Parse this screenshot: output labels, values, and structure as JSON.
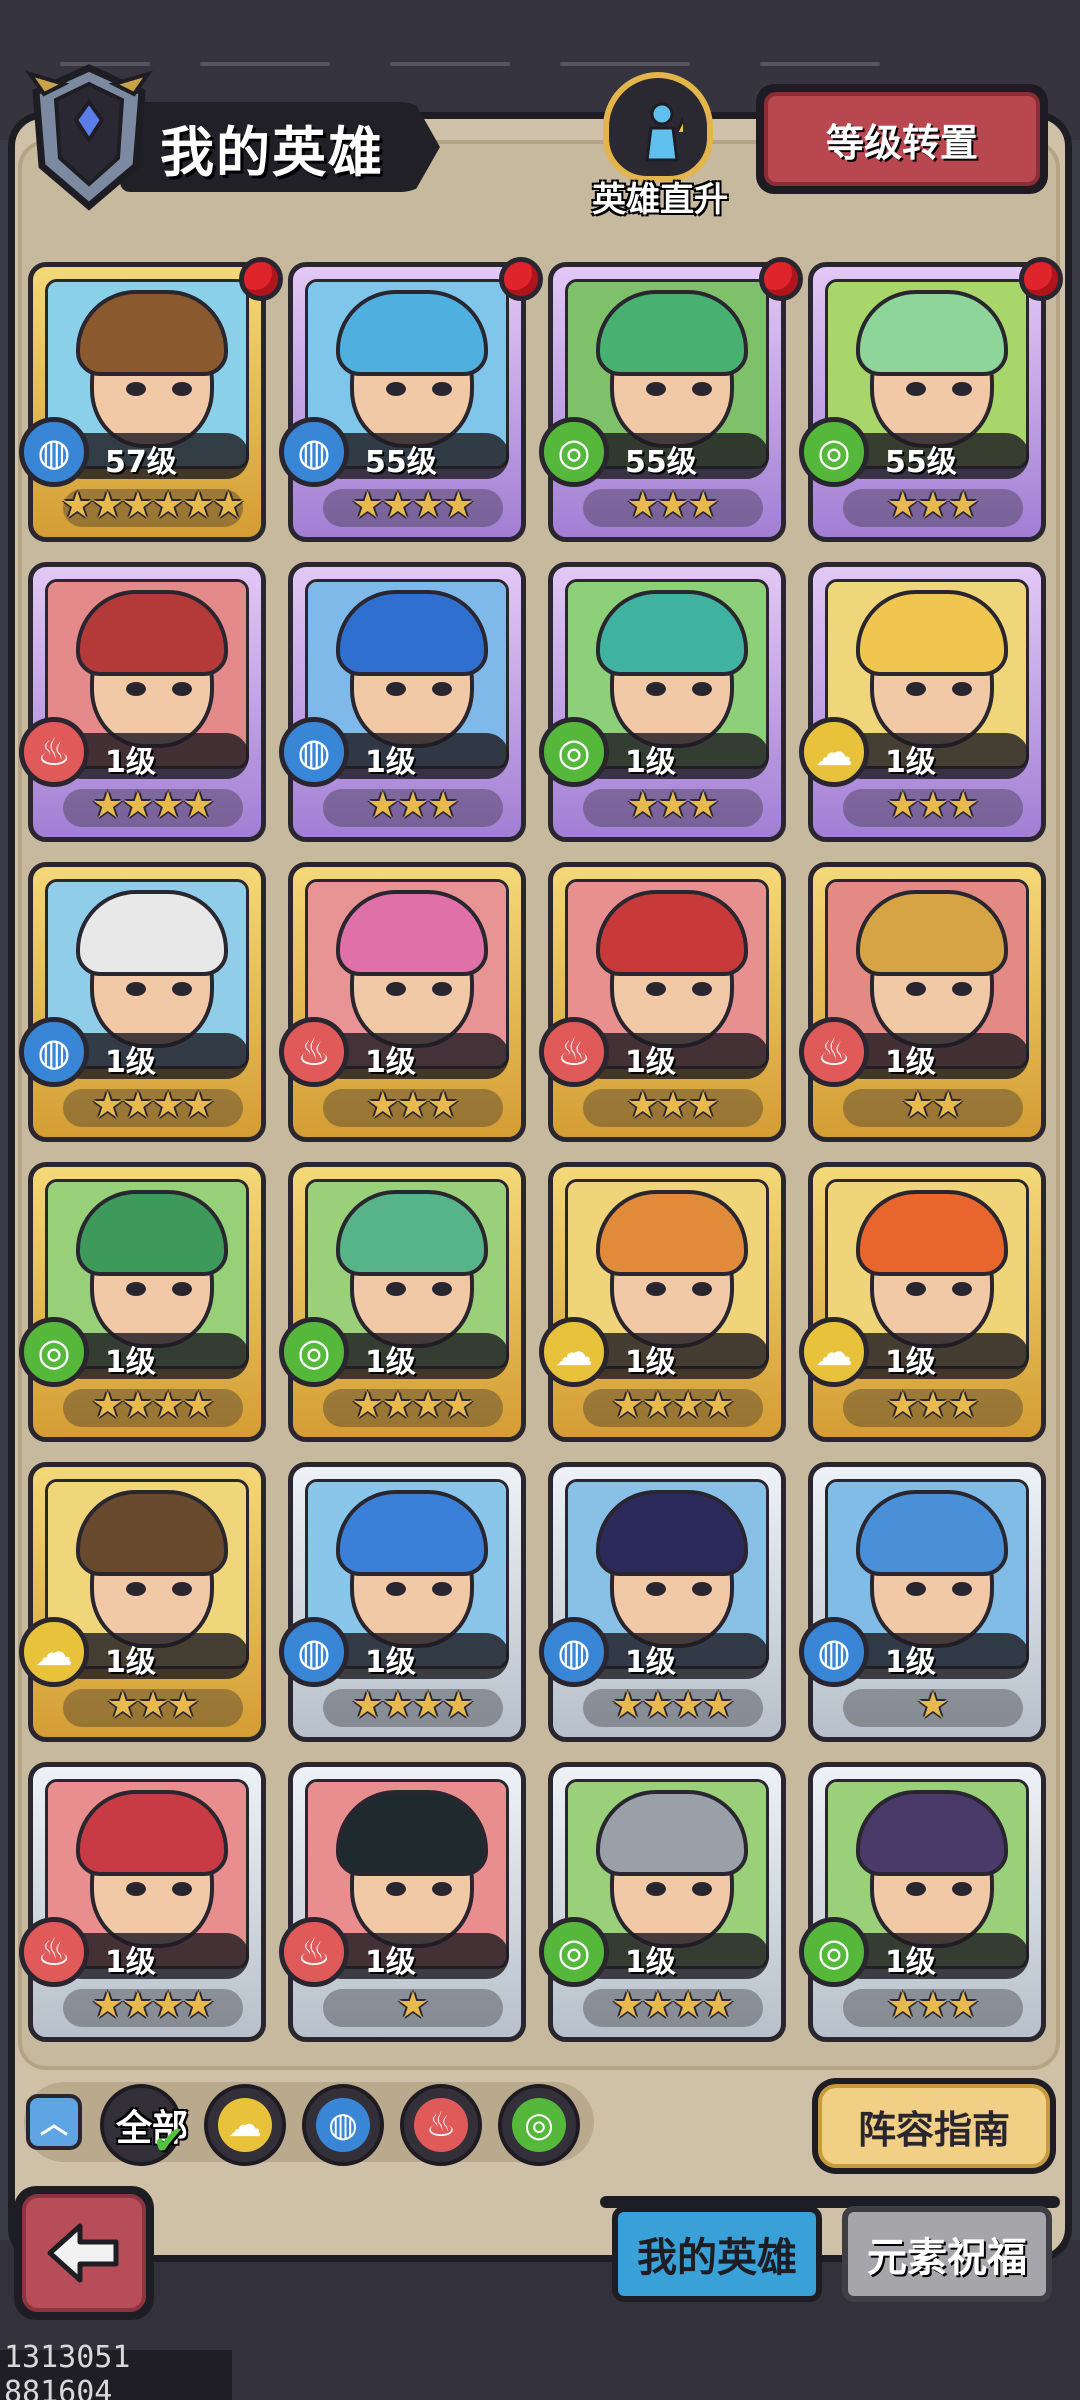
{
  "header": {
    "title": "我的英雄",
    "ascend_label": "英雄直升",
    "level_transfer_label": "等级转置"
  },
  "heroes": [
    {
      "level": "57级",
      "stars": "★★★★★★",
      "element": "water",
      "frame": "gold",
      "red_dot": true,
      "portrait_bg": "#8ad0e8",
      "hair": "#8a5a2e"
    },
    {
      "level": "55级",
      "stars": "★★★★",
      "element": "water",
      "frame": "purple",
      "red_dot": true,
      "portrait_bg": "#7fc6ea",
      "hair": "#4fb0e0"
    },
    {
      "level": "55级",
      "stars": "★★★",
      "element": "wind",
      "frame": "purple",
      "red_dot": true,
      "portrait_bg": "#7fc06a",
      "hair": "#48b070"
    },
    {
      "level": "55级",
      "stars": "★★★",
      "element": "wind",
      "frame": "purple",
      "red_dot": true,
      "portrait_bg": "#a8d66a",
      "hair": "#8ed59a"
    },
    {
      "level": "1级",
      "stars": "★★★★",
      "element": "fire",
      "frame": "purple",
      "red_dot": false,
      "portrait_bg": "#e48a8a",
      "hair": "#b43a3a"
    },
    {
      "level": "1级",
      "stars": "★★★",
      "element": "water",
      "frame": "purple",
      "red_dot": false,
      "portrait_bg": "#7fb9ea",
      "hair": "#2f6fd0"
    },
    {
      "level": "1级",
      "stars": "★★★",
      "element": "wind",
      "frame": "purple",
      "red_dot": false,
      "portrait_bg": "#8ed07a",
      "hair": "#3fb2a0"
    },
    {
      "level": "1级",
      "stars": "★★★",
      "element": "earth",
      "frame": "purple",
      "red_dot": false,
      "portrait_bg": "#f0d67a",
      "hair": "#f0c650"
    },
    {
      "level": "1级",
      "stars": "★★★★",
      "element": "water",
      "frame": "gold",
      "red_dot": false,
      "portrait_bg": "#8fcde8",
      "hair": "#e8e8e8"
    },
    {
      "level": "1级",
      "stars": "★★★",
      "element": "fire",
      "frame": "gold",
      "red_dot": false,
      "portrait_bg": "#e89494",
      "hair": "#e070a8"
    },
    {
      "level": "1级",
      "stars": "★★★",
      "element": "fire",
      "frame": "gold",
      "red_dot": false,
      "portrait_bg": "#e89090",
      "hair": "#c83a3a"
    },
    {
      "level": "1级",
      "stars": "★★",
      "element": "fire",
      "frame": "gold",
      "red_dot": false,
      "portrait_bg": "#e48a84",
      "hair": "#d6a444"
    },
    {
      "level": "1级",
      "stars": "★★★★",
      "element": "wind",
      "frame": "gold",
      "red_dot": false,
      "portrait_bg": "#98d07a",
      "hair": "#3e9a5a"
    },
    {
      "level": "1级",
      "stars": "★★★★",
      "element": "wind",
      "frame": "gold",
      "red_dot": false,
      "portrait_bg": "#9ad07a",
      "hair": "#56b488"
    },
    {
      "level": "1级",
      "stars": "★★★★",
      "element": "earth",
      "frame": "gold",
      "red_dot": false,
      "portrait_bg": "#f0d47a",
      "hair": "#e08a3a"
    },
    {
      "level": "1级",
      "stars": "★★★",
      "element": "earth",
      "frame": "gold",
      "red_dot": false,
      "portrait_bg": "#f0d47a",
      "hair": "#e8662e"
    },
    {
      "level": "1级",
      "stars": "★★★",
      "element": "earth",
      "frame": "gold",
      "red_dot": false,
      "portrait_bg": "#f0d67a",
      "hair": "#6a4a2e"
    },
    {
      "level": "1级",
      "stars": "★★★★",
      "element": "water",
      "frame": "silver",
      "red_dot": false,
      "portrait_bg": "#8ac6ea",
      "hair": "#3a80d8"
    },
    {
      "level": "1级",
      "stars": "★★★★",
      "element": "water",
      "frame": "silver",
      "red_dot": false,
      "portrait_bg": "#88c0e6",
      "hair": "#2c2a5a"
    },
    {
      "level": "1级",
      "stars": "★",
      "element": "water",
      "frame": "silver",
      "red_dot": false,
      "portrait_bg": "#80bce6",
      "hair": "#4a90d8"
    },
    {
      "level": "1级",
      "stars": "★★★★",
      "element": "fire",
      "frame": "silver",
      "red_dot": false,
      "portrait_bg": "#e88e8e",
      "hair": "#c83a44"
    },
    {
      "level": "1级",
      "stars": "★",
      "element": "fire",
      "frame": "silver",
      "red_dot": false,
      "portrait_bg": "#e88e8e",
      "hair": "#1e2a2e"
    },
    {
      "level": "1级",
      "stars": "★★★★",
      "element": "wind",
      "frame": "silver",
      "red_dot": false,
      "portrait_bg": "#9ad07a",
      "hair": "#9aa0a8"
    },
    {
      "level": "1级",
      "stars": "★★★",
      "element": "wind",
      "frame": "silver",
      "red_dot": false,
      "portrait_bg": "#9ad07a",
      "hair": "#4a3a6a"
    }
  ],
  "element_glyphs": {
    "water": "◍",
    "fire": "♨",
    "wind": "◎",
    "earth": "☁"
  },
  "filters": {
    "all_label": "全部",
    "items": [
      {
        "element": "earth",
        "color": "#e8c23a"
      },
      {
        "element": "water",
        "color": "#3a86d6"
      },
      {
        "element": "fire",
        "color": "#e05a5a"
      },
      {
        "element": "wind",
        "color": "#55b83b"
      }
    ]
  },
  "guide_label": "阵容指南",
  "tabs": {
    "my_heroes": "我的英雄",
    "element_blessing": "元素祝福"
  },
  "watermark": "1313051 881604"
}
